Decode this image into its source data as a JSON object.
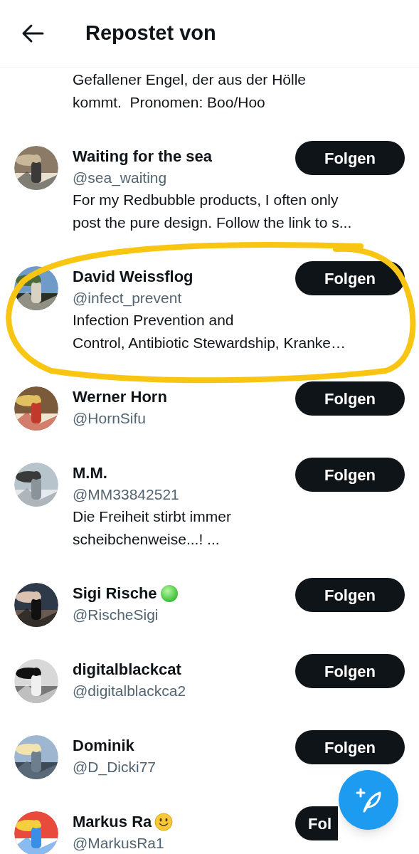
{
  "header": {
    "title": "Repostet von"
  },
  "partial_bio_lines": [
    "Gefallener Engel, der aus der Hölle",
    "kommt.  Pronomen: Boo/Hoo"
  ],
  "users": [
    {
      "name": "Waiting for the sea",
      "handle": "@sea_waiting",
      "bio_lines": [
        "For my Redbubble products, I often only",
        "post the pure design. Follow the link to s..."
      ],
      "button": "Folgen"
    },
    {
      "name": "David Weissflog",
      "handle": "@infect_prevent",
      "bio_lines": [
        "Infection Prevention and",
        "Control, Antibiotic Stewardship, Kranke…"
      ],
      "button": "Folgen",
      "highlighted": true
    },
    {
      "name": "Werner Horn",
      "handle": "@HornSifu",
      "button": "Folgen"
    },
    {
      "name": "M.M.",
      "handle": "@MM33842521",
      "bio_lines": [
        "Die Freiheit stirbt immer",
        "scheibchenweise...! ..."
      ],
      "button": "Folgen"
    },
    {
      "name": "Sigi Rische",
      "emoji": {
        "kind": "circle"
      },
      "handle": "@RischeSigi",
      "button": "Folgen"
    },
    {
      "name": "digitalblackcat",
      "handle": "@digitalblackca2",
      "button": "Folgen"
    },
    {
      "name": "Dominik",
      "handle": "@D_Dicki77",
      "button": "Folgen"
    },
    {
      "name": "Markus Ra",
      "emoji": {
        "kind": "smiley"
      },
      "handle": "@MarkusRa1",
      "button": "Fol",
      "button_covered": true
    }
  ]
}
